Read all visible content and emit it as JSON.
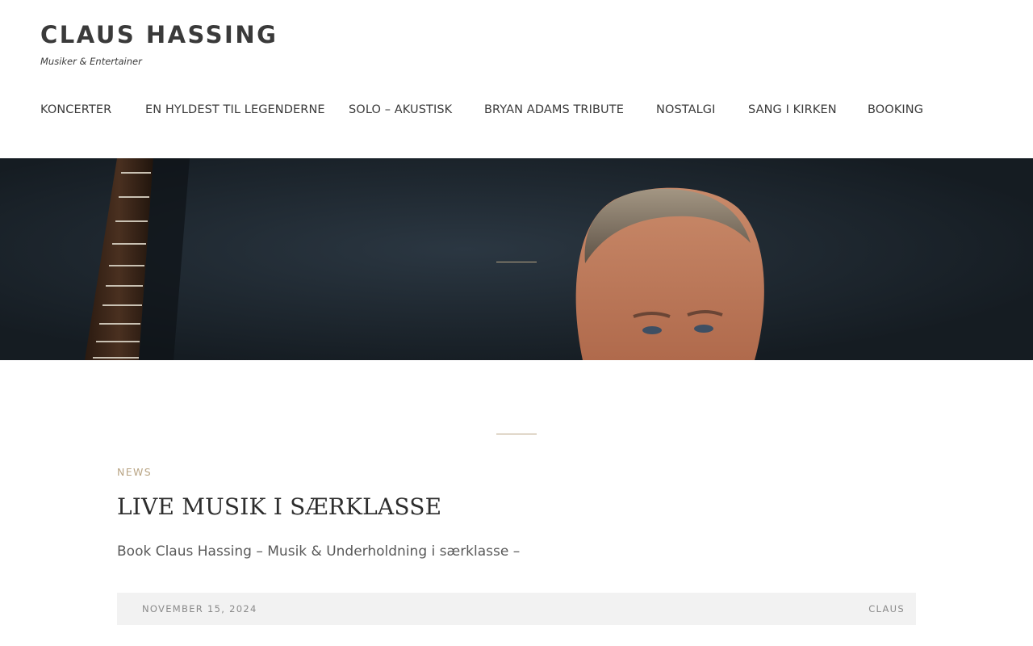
{
  "site": {
    "title": "CLAUS HASSING",
    "tagline": "Musiker & Entertainer"
  },
  "nav": {
    "items": [
      {
        "label": "KONCERTER"
      },
      {
        "label": "EN HYLDEST TIL LEGENDERNE"
      },
      {
        "label": "SOLO – AKUSTISK"
      },
      {
        "label": "BRYAN ADAMS TRIBUTE"
      },
      {
        "label": "NOSTALGI"
      },
      {
        "label": "SANG I KIRKEN"
      },
      {
        "label": "BOOKING"
      }
    ]
  },
  "post": {
    "category": "NEWS",
    "title": "LIVE MUSIK I SÆRKLASSE",
    "excerpt": "Book Claus Hassing – Musik & Underholdning i særklasse –",
    "date": "NOVEMBER 15, 2024",
    "author": "CLAUS"
  },
  "colors": {
    "accent": "#b9a585",
    "text": "#3a3a3a",
    "meta_bg": "#f2f2f2"
  }
}
